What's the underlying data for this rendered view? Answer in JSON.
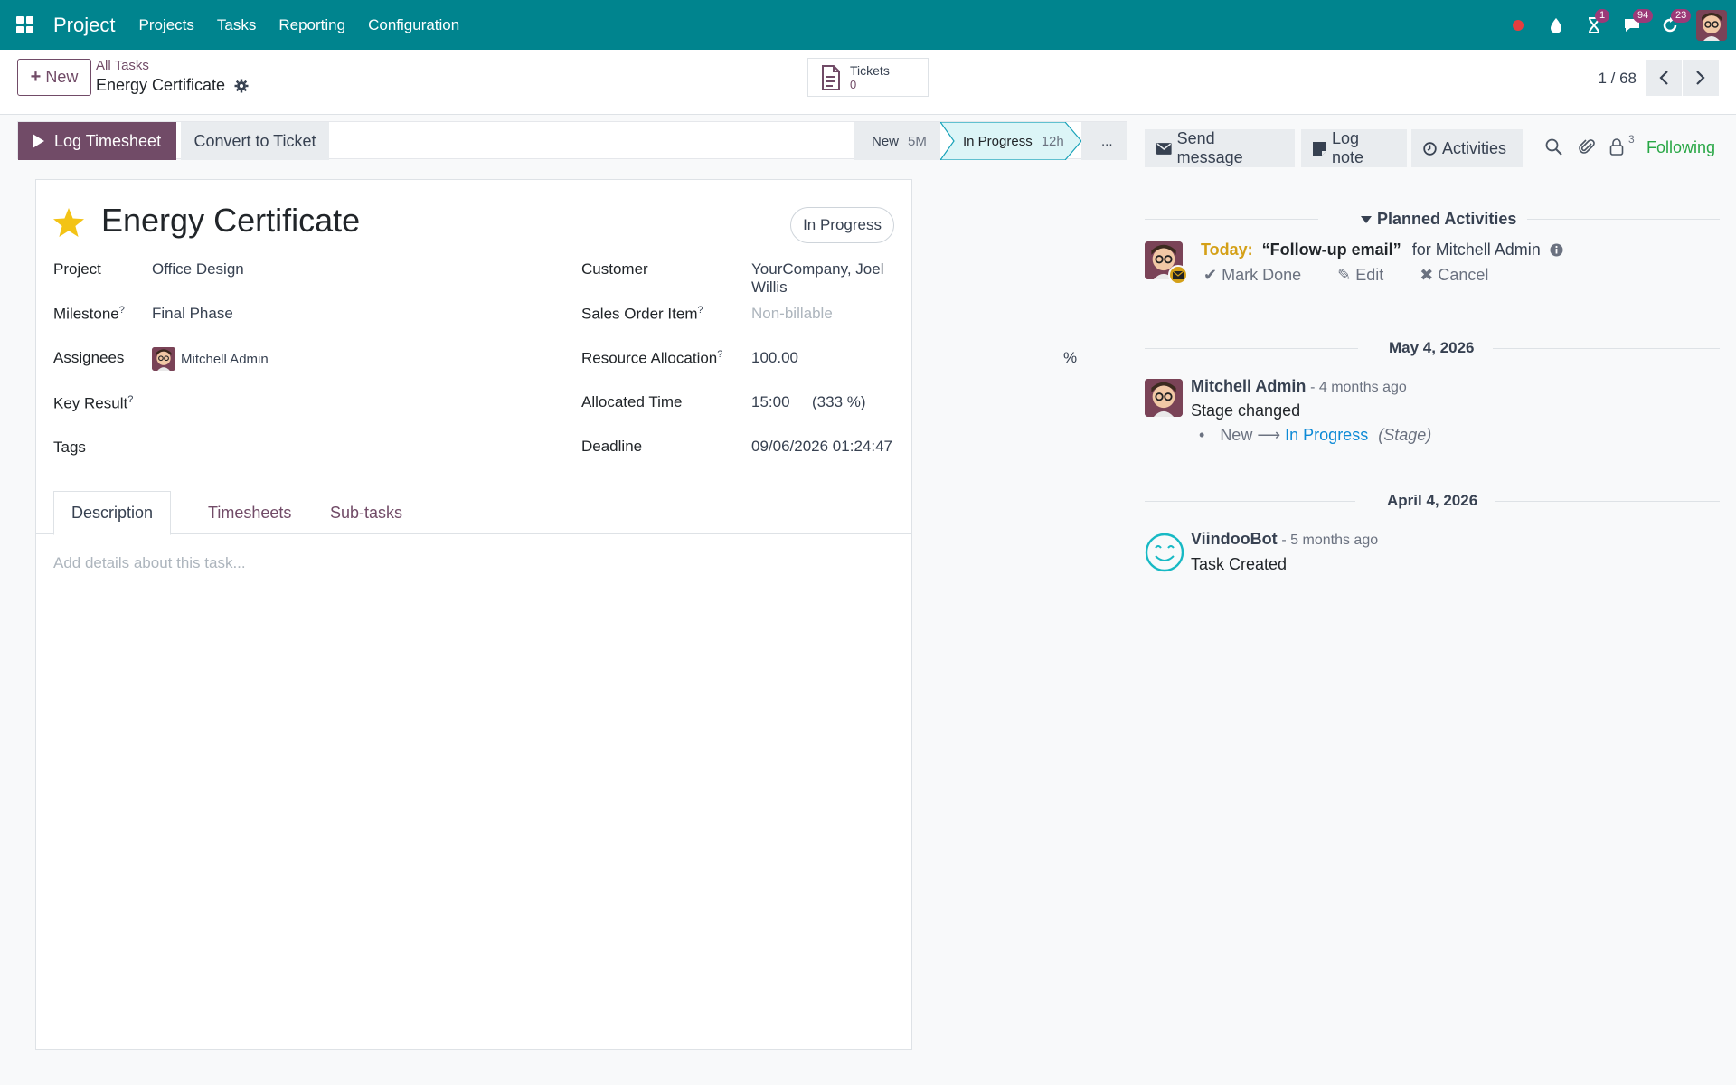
{
  "navbar": {
    "app_name": "Project",
    "menu": [
      "Projects",
      "Tasks",
      "Reporting",
      "Configuration"
    ],
    "badges": {
      "activities": "1",
      "messages": "94",
      "updates": "23"
    }
  },
  "control": {
    "new_label": "New",
    "breadcrumb_parent": "All Tasks",
    "breadcrumb_current": "Energy Certificate",
    "smart_button": {
      "label": "Tickets",
      "count": "0"
    },
    "pager": "1 / 68"
  },
  "statusbar": {
    "log_timesheet": "Log Timesheet",
    "convert_ticket": "Convert to Ticket",
    "stages": [
      {
        "name": "New",
        "duration": "5M"
      },
      {
        "name": "In Progress",
        "duration": "12h"
      }
    ],
    "more": "..."
  },
  "form": {
    "title": "Energy Certificate",
    "state": "In Progress",
    "left": {
      "project_label": "Project",
      "project_value": "Office Design",
      "milestone_label": "Milestone",
      "milestone_value": "Final Phase",
      "assignees_label": "Assignees",
      "assignee_value": "Mitchell Admin",
      "key_result_label": "Key Result",
      "tags_label": "Tags"
    },
    "right": {
      "customer_label": "Customer",
      "customer_value": "YourCompany, Joel Willis",
      "sol_label": "Sales Order Item",
      "sol_placeholder": "Non-billable",
      "resource_label": "Resource Allocation",
      "resource_value": "100.00",
      "resource_unit": "%",
      "allocated_label": "Allocated Time",
      "allocated_value": "15:00",
      "allocated_pct": "(333 %)",
      "deadline_label": "Deadline",
      "deadline_value": "09/06/2026 01:24:47"
    },
    "tooltip_mark": "?",
    "tabs": [
      "Description",
      "Timesheets",
      "Sub-tasks"
    ],
    "description_placeholder": "Add details about this task..."
  },
  "chatter": {
    "send_message": "Send message",
    "log_note": "Log note",
    "activities": "Activities",
    "followers_count": "3",
    "following": "Following",
    "planned_title": "Planned Activities",
    "activity": {
      "today": "Today:",
      "summary": "“Follow-up email”",
      "for": "for Mitchell Admin",
      "mark_done": "Mark Done",
      "edit": "Edit",
      "cancel": "Cancel"
    },
    "groups": [
      {
        "date": "May 4, 2026",
        "author": "Mitchell Admin",
        "time": "- 4 months ago",
        "body": "Stage changed",
        "tracking_old": "New",
        "tracking_new": "In Progress",
        "tracking_field": "(Stage)"
      },
      {
        "date": "April 4, 2026",
        "author": "ViindooBot",
        "time": "- 5 months ago",
        "body": "Task Created"
      }
    ]
  },
  "colors": {
    "navbar": "#00848e",
    "primary": "#714b67",
    "following": "#28a745",
    "today": "#d4a017"
  }
}
